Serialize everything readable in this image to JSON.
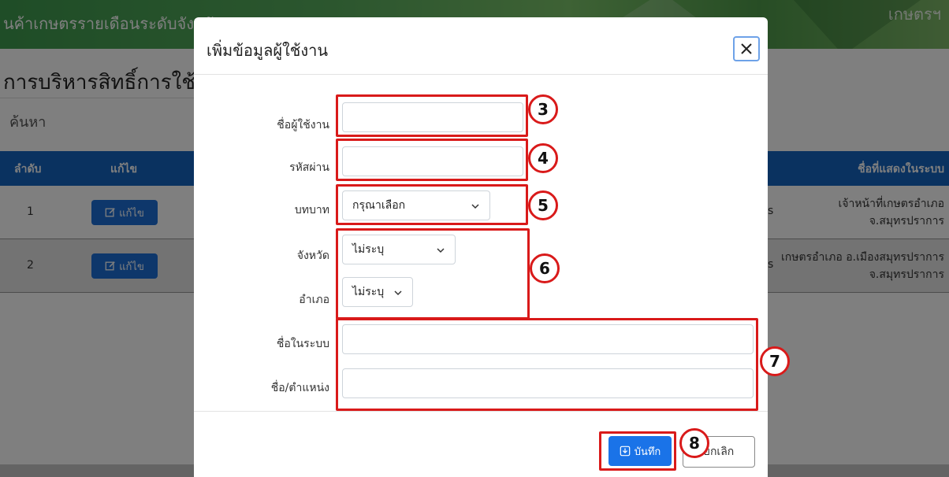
{
  "background": {
    "banner_title": "นค้าเกษตรรายเดือนระดับจังหวัด",
    "banner_right": "เกษตรฯ",
    "page_heading": "การบริหารสิทธิ์การใช้งาน",
    "search_label": "ค้นหา",
    "table": {
      "headers": {
        "order": "ลำดับ",
        "edit": "แก้ไข",
        "display_name": "ชื่อที่แสดงในระบบ"
      },
      "rows": [
        {
          "no": "1",
          "edit_label": "แก้ไข",
          "fragment": "s",
          "display_line1": "เจ้าหน้าที่เกษตรอำเภอ",
          "display_line2": "จ.สมุทรปราการ"
        },
        {
          "no": "2",
          "edit_label": "แก้ไข",
          "fragment": "s",
          "display_line1": "เกษตรอำเภอ อ.เมืองสมุทรปราการ",
          "display_line2": "จ.สมุทรปราการ"
        }
      ]
    }
  },
  "modal": {
    "title": "เพิ่มข้อมูลผู้ใช้งาน",
    "fields": {
      "username": {
        "label": "ชื่อผู้ใช้งาน",
        "value": ""
      },
      "password": {
        "label": "รหัสผ่าน",
        "value": ""
      },
      "role": {
        "label": "บทบาท",
        "selected": "กรุณาเลือก"
      },
      "province": {
        "label": "จังหวัด",
        "selected": "ไม่ระบุ"
      },
      "district": {
        "label": "อำเภอ",
        "selected": "ไม่ระบุ"
      },
      "system_name": {
        "label": "ชื่อในระบบ",
        "value": ""
      },
      "name_position": {
        "label": "ชื่อ/ตำแหน่ง",
        "value": ""
      }
    },
    "save_label": "บันทึก",
    "cancel_label": "ยกเลิก"
  },
  "annotations": {
    "badges": [
      "3",
      "4",
      "5",
      "6",
      "7",
      "8"
    ],
    "color": "#d91a1a"
  },
  "colors": {
    "primary": "#1a73e8",
    "table_header": "#1565c0",
    "banner": "#4caf50"
  }
}
